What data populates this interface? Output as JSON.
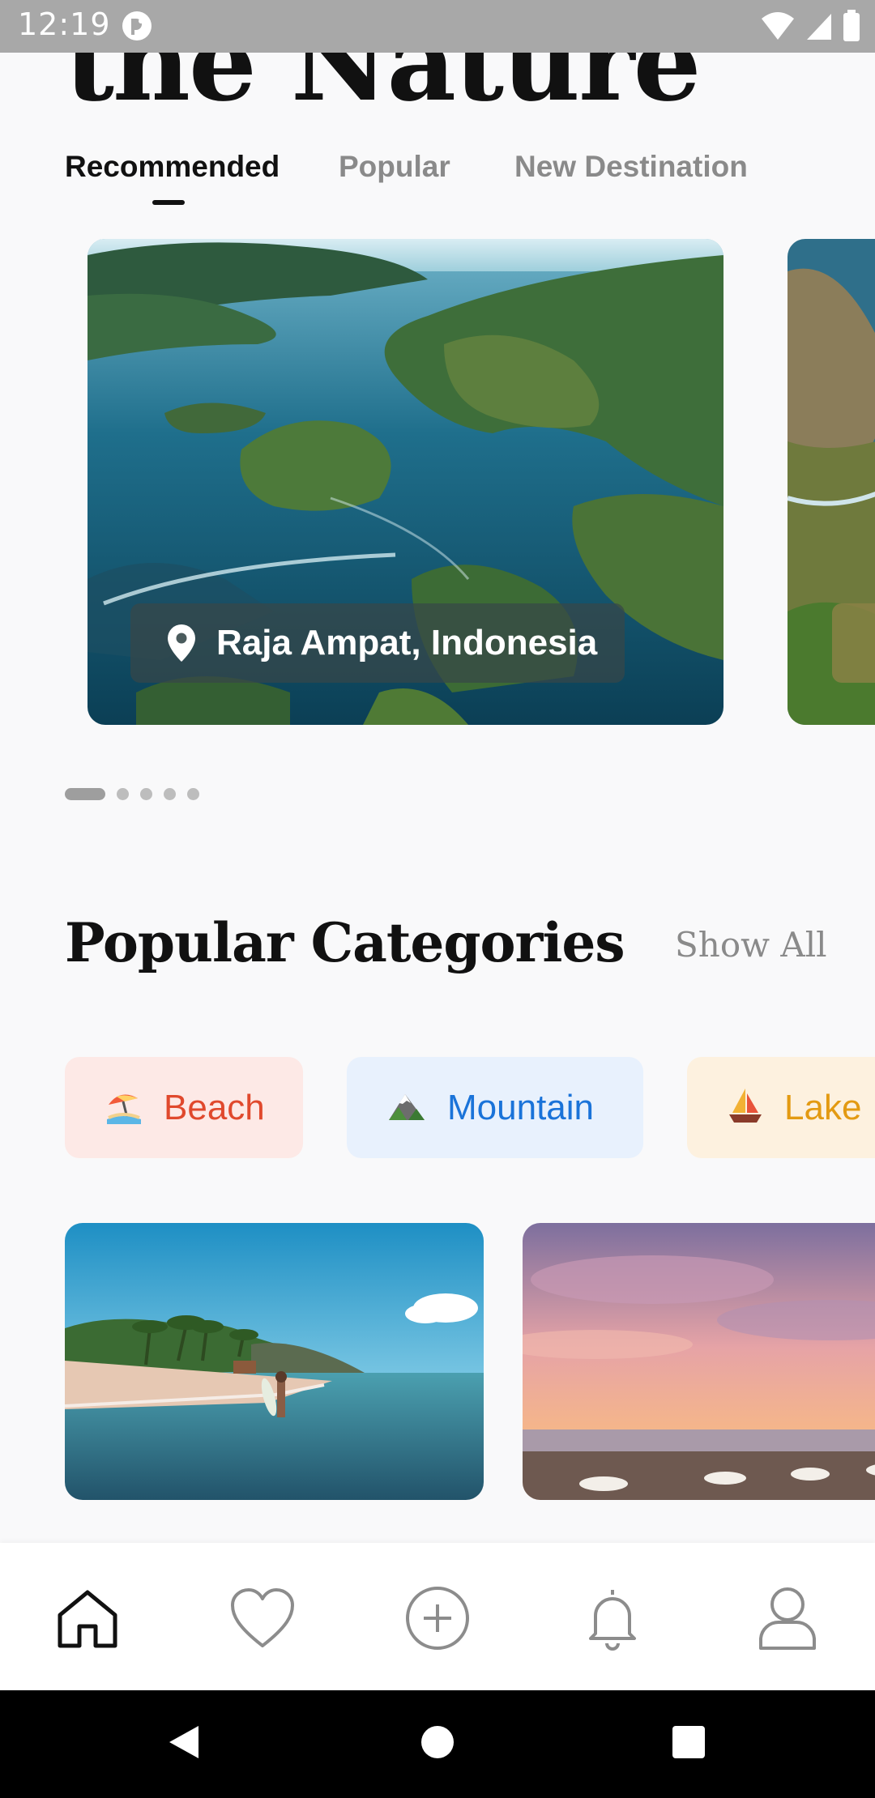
{
  "status_bar": {
    "time": "12:19"
  },
  "hero": {
    "title": "the Nature"
  },
  "tabs": [
    {
      "label": "Recommended",
      "active": true
    },
    {
      "label": "Popular",
      "active": false
    },
    {
      "label": "New Destination",
      "active": false
    }
  ],
  "featured": {
    "cards": [
      {
        "location": "Raja Ampat, Indonesia"
      }
    ],
    "pager": {
      "count": 5,
      "active_index": 0
    }
  },
  "categories_section": {
    "title": "Popular Categories",
    "show_all_label": "Show All",
    "chips": [
      {
        "label": "Beach",
        "icon": "beach-umbrella-icon",
        "color": "#e0492d",
        "bg": "#fde9e6"
      },
      {
        "label": "Mountain",
        "icon": "mountain-icon",
        "color": "#1a73d9",
        "bg": "#e8f1fd"
      },
      {
        "label": "Lake",
        "icon": "sailboat-icon",
        "color": "#e39a12",
        "bg": "#fdf1df"
      }
    ]
  },
  "bottom_nav": {
    "items": [
      {
        "icon": "home-icon",
        "active": true
      },
      {
        "icon": "heart-icon",
        "active": false
      },
      {
        "icon": "add-circle-icon",
        "active": false
      },
      {
        "icon": "bell-icon",
        "active": false
      },
      {
        "icon": "profile-icon",
        "active": false
      }
    ]
  },
  "system_nav": {
    "buttons": [
      "back-icon",
      "home-circle-icon",
      "recents-icon"
    ]
  }
}
